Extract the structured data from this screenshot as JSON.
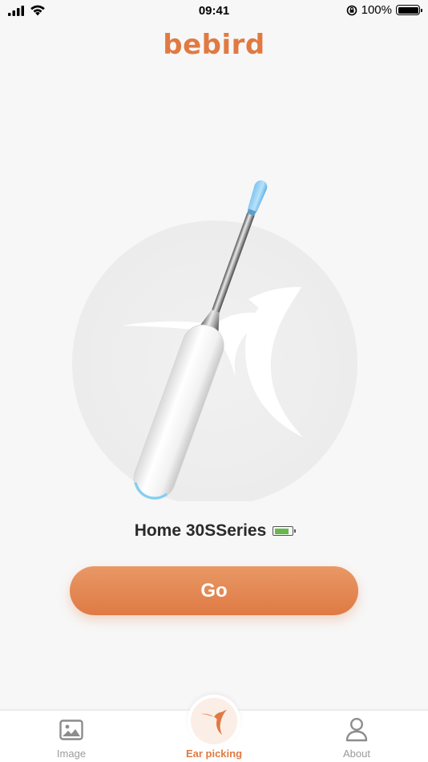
{
  "status_bar": {
    "time": "09:41",
    "battery_percent": "100%",
    "icons": [
      "cellular-signal-icon",
      "wifi-icon",
      "orientation-lock-icon",
      "battery-icon"
    ]
  },
  "header": {
    "brand": "bebird"
  },
  "device": {
    "name": "Home 30SSeries",
    "battery_level": 0.8,
    "battery_color": "#67b84d"
  },
  "actions": {
    "go_label": "Go"
  },
  "tab_bar": {
    "tabs": [
      {
        "label": "Image",
        "icon": "image-icon",
        "active": false
      },
      {
        "label": "Ear picking",
        "icon": "bird-logo-icon",
        "active": true
      },
      {
        "label": "About",
        "icon": "person-icon",
        "active": false
      }
    ]
  },
  "colors": {
    "accent": "#e07a42",
    "background": "#f7f7f7",
    "inactive_tab": "#9a9a9a"
  }
}
